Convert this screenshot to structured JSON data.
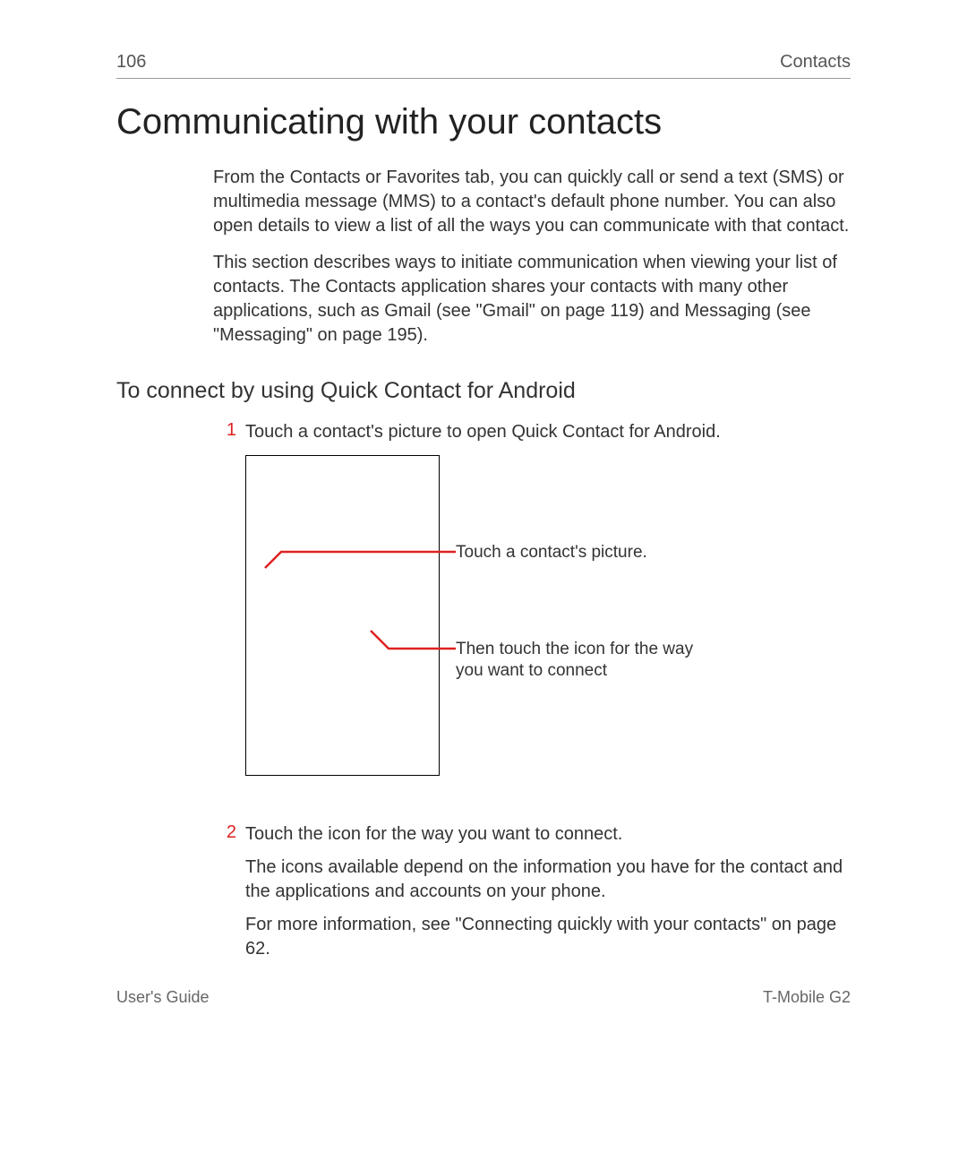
{
  "header": {
    "page_number": "106",
    "section": "Contacts"
  },
  "title": "Communicating with your contacts",
  "intro": {
    "p1": "From the Contacts or Favorites tab, you can quickly call or send a text (SMS) or multimedia message (MMS) to a contact's default phone number. You can also open details to view a list of all the ways you can communicate with that contact.",
    "p2": "This section describes ways to initiate communication when viewing your list of contacts. The Contacts application shares your contacts with many other applications, such as Gmail (see \"Gmail\" on page 119) and Messaging (see \"Messaging\" on page 195)."
  },
  "subhead": "To connect by using Quick Contact for Android",
  "steps": {
    "s1": {
      "num": "1",
      "text": "Touch a contact's picture to open Quick Contact for Android."
    },
    "s2": {
      "num": "2",
      "p1": "Touch the icon for the way you want to connect.",
      "p2": "The icons available depend on the information you have for the contact and the applications and accounts on your phone.",
      "p3": "For more information, see \"Connecting quickly with your contacts\" on page 62."
    }
  },
  "callouts": {
    "c1": "Touch a contact's picture.",
    "c2": "Then touch the icon for the way you want to connect"
  },
  "footer": {
    "left": "User's Guide",
    "right": "T-Mobile G2"
  },
  "colors": {
    "accent_red": "#d22"
  }
}
